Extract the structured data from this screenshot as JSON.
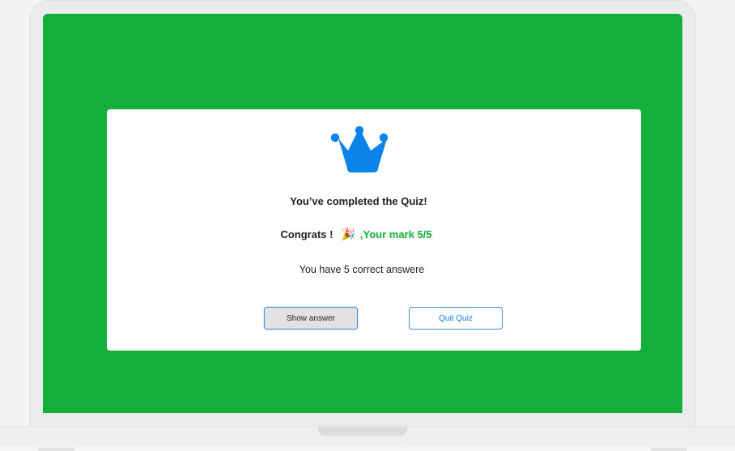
{
  "colors": {
    "screen_background": "#12b03b",
    "card_background": "#ffffff",
    "crown": "#0a84e8",
    "mark_text": "#12b03b",
    "button_border": "#3f8fe0"
  },
  "result": {
    "crown_icon": "crown-icon",
    "title": "You’ve completed the Quiz!",
    "congrats_label": "Congrats !",
    "party_icon": "🎉",
    "mark_text": ",Your mark 5/5",
    "correct_text": "You have 5 correct answere"
  },
  "buttons": {
    "show_answer_label": "Show answer",
    "quit_quiz_label": "Quit Quiz"
  }
}
